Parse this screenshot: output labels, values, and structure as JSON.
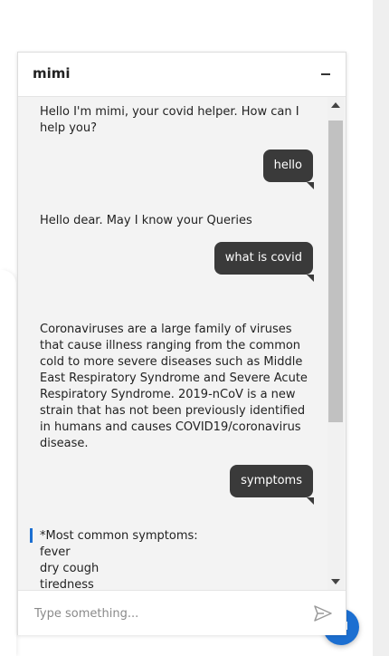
{
  "chat": {
    "title": "mimi",
    "input_placeholder": "Type something...",
    "messages": [
      {
        "from": "bot",
        "text": "Hello I'm mimi, your covid helper. How can I help you?"
      },
      {
        "from": "user",
        "text": "hello"
      },
      {
        "from": "bot",
        "text": "Hello dear. May I know your Queries"
      },
      {
        "from": "user",
        "text": "what is covid"
      },
      {
        "from": "bot",
        "text": "Coronaviruses are a large family of viruses that cause illness ranging from the common cold to more severe diseases such as Middle East Respiratory Syndrome and Severe Acute Respiratory Syndrome. 2019-nCoV is a new strain that has not been previously identified in humans and causes COVID19/coronavirus disease."
      },
      {
        "from": "user",
        "text": "symptoms"
      }
    ],
    "symptoms_message": [
      "*Most common symptoms:",
      "fever",
      "dry cough",
      "tiredness"
    ]
  },
  "colors": {
    "accent": "#1c6fd1",
    "user_bubble": "#3a3a3a",
    "chat_background": "#f3f3f3"
  },
  "icons": {
    "minimize": "minus-icon",
    "send": "send-arrow-icon",
    "launcher": "chat-launcher-icon"
  }
}
